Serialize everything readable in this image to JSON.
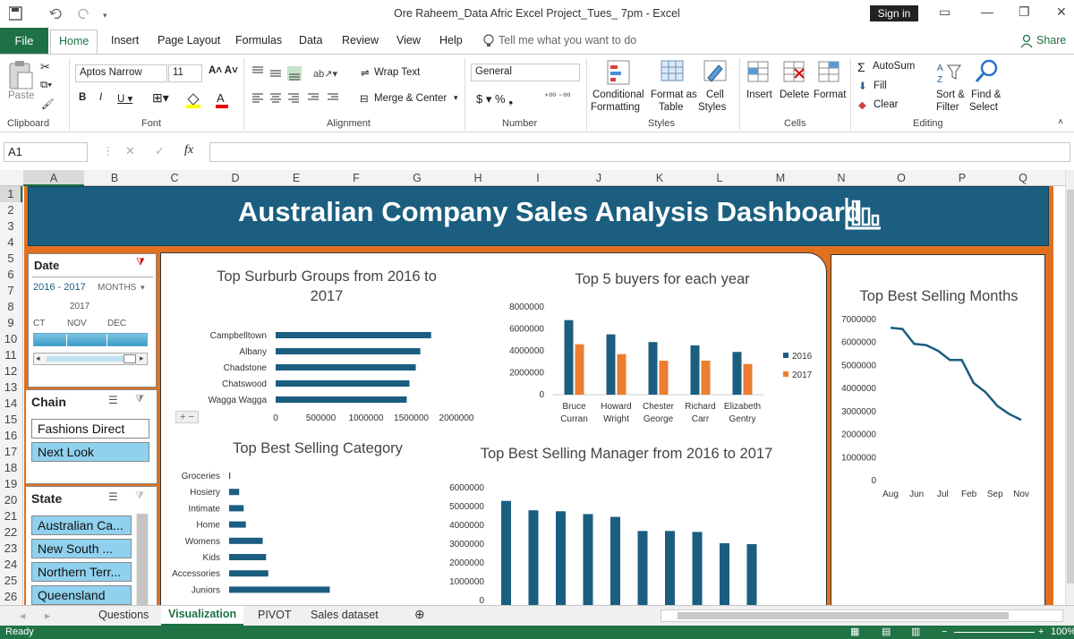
{
  "window": {
    "title": "Ore Raheem_Data Afric Excel Project_Tues_ 7pm  -  Excel",
    "signin": "Sign in"
  },
  "menu": {
    "file": "File",
    "tabs": [
      "Home",
      "Insert",
      "Page Layout",
      "Formulas",
      "Data",
      "Review",
      "View",
      "Help"
    ],
    "tell_me": "Tell me what you want to do",
    "share": "Share"
  },
  "ribbon": {
    "clipboard": {
      "paste": "Paste",
      "label": "Clipboard"
    },
    "font": {
      "name": "Aptos Narrow",
      "size": "11",
      "label": "Font"
    },
    "alignment": {
      "wrap": "Wrap Text",
      "merge": "Merge & Center",
      "label": "Alignment"
    },
    "number": {
      "format": "General",
      "label": "Number"
    },
    "styles": {
      "conditional": "Conditional",
      "formatting": "Formatting",
      "format_as": "Format as",
      "table": "Table",
      "cell": "Cell",
      "cell_styles": "Styles",
      "label": "Styles"
    },
    "cells": {
      "insert": "Insert",
      "delete": "Delete",
      "format": "Format",
      "label": "Cells"
    },
    "editing": {
      "autosum": "AutoSum",
      "fill": "Fill",
      "clear": "Clear",
      "sort": "Sort &",
      "sort2": "Filter",
      "find": "Find &",
      "find2": "Select",
      "label": "Editing"
    }
  },
  "formula_bar": {
    "name_box": "A1",
    "value": ""
  },
  "columns": [
    "A",
    "B",
    "C",
    "D",
    "E",
    "F",
    "G",
    "H",
    "I",
    "J",
    "K",
    "L",
    "M",
    "N",
    "O",
    "P",
    "Q"
  ],
  "rows": [
    "1",
    "2",
    "3",
    "4",
    "5",
    "6",
    "7",
    "8",
    "9",
    "10",
    "11",
    "12",
    "13",
    "14",
    "15",
    "16",
    "17",
    "18",
    "19",
    "20",
    "21",
    "22",
    "23",
    "24",
    "25",
    "26"
  ],
  "dashboard": {
    "title": "Australian Company Sales Analysis Dashboard",
    "date_slicer": {
      "header": "Date",
      "range": "2016 - 2017",
      "level": "MONTHS",
      "year": "2017",
      "months": [
        "CT",
        "NOV",
        "DEC"
      ]
    },
    "chain_slicer": {
      "header": "Chain",
      "items": [
        "Fashions Direct",
        "Next Look"
      ]
    },
    "state_slicer": {
      "header": "State",
      "items": [
        "Australian Ca...",
        "New South ...",
        "Northern Terr...",
        "Queensland"
      ]
    }
  },
  "chart_data": [
    {
      "type": "bar",
      "title": "Top Surburb Groups from 2016 to 2017",
      "categories": [
        "Campbelltown",
        "Albany",
        "Chadstone",
        "Chatswood",
        "Wagga Wagga"
      ],
      "values": [
        1720000,
        1600000,
        1550000,
        1480000,
        1450000
      ],
      "xlim": [
        0,
        2000000
      ],
      "ticks": [
        "0",
        "500000",
        "1000000",
        "1500000",
        "2000000"
      ],
      "color": "#1b5e80"
    },
    {
      "type": "bar",
      "title": "Top 5 buyers for each year",
      "categories": [
        "Bruce Curran",
        "Howard Wright",
        "Chester George",
        "Richard Carr",
        "Elizabeth Gentry"
      ],
      "series": [
        {
          "name": "2016",
          "values": [
            6800000,
            5500000,
            4800000,
            4500000,
            3900000
          ],
          "color": "#1b5e80"
        },
        {
          "name": "2017",
          "values": [
            4600000,
            3700000,
            3100000,
            3100000,
            2800000
          ],
          "color": "#ed7d31"
        }
      ],
      "ylim": [
        0,
        8000000
      ],
      "ticks": [
        "0",
        "2000000",
        "4000000",
        "6000000",
        "8000000"
      ]
    },
    {
      "type": "line",
      "title": "Top Best Selling Months",
      "x": [
        "Aug",
        "Jun",
        "Jul",
        "Feb",
        "Sep",
        "Nov"
      ],
      "values": [
        6600000,
        6550000,
        5900000,
        5850000,
        5600000,
        5200000,
        5200000,
        4200000,
        3800000,
        3200000,
        2850000,
        2600000
      ],
      "ylim": [
        0,
        7000000
      ],
      "ticks": [
        "0",
        "1000000",
        "2000000",
        "3000000",
        "4000000",
        "5000000",
        "6000000",
        "7000000"
      ],
      "color": "#1b5e80"
    },
    {
      "type": "bar",
      "title": "Top Best Selling Category",
      "categories": [
        "Groceries",
        "Hosiery",
        "Intimate",
        "Home",
        "Womens",
        "Kids",
        "Accessories",
        "Juniors"
      ],
      "values": [
        1,
        9,
        13,
        15,
        30,
        33,
        35,
        90
      ],
      "xlim": [
        0,
        100
      ],
      "color": "#1b5e80"
    },
    {
      "type": "bar",
      "title": "Top Best Selling Manager from 2016 to 2017",
      "values": [
        5300000,
        4800000,
        4750000,
        4600000,
        4450000,
        3700000,
        3700000,
        3650000,
        3050000,
        3000000
      ],
      "ylim": [
        0,
        6000000
      ],
      "ticks": [
        "0",
        "1000000",
        "2000000",
        "3000000",
        "4000000",
        "5000000",
        "6000000"
      ],
      "color": "#1b5e80"
    }
  ],
  "sheets": {
    "tabs": [
      "Questions",
      "Visualization",
      "PIVOT",
      "Sales dataset"
    ],
    "active": "Visualization"
  },
  "status": {
    "text": "Ready",
    "zoom": "100%"
  }
}
